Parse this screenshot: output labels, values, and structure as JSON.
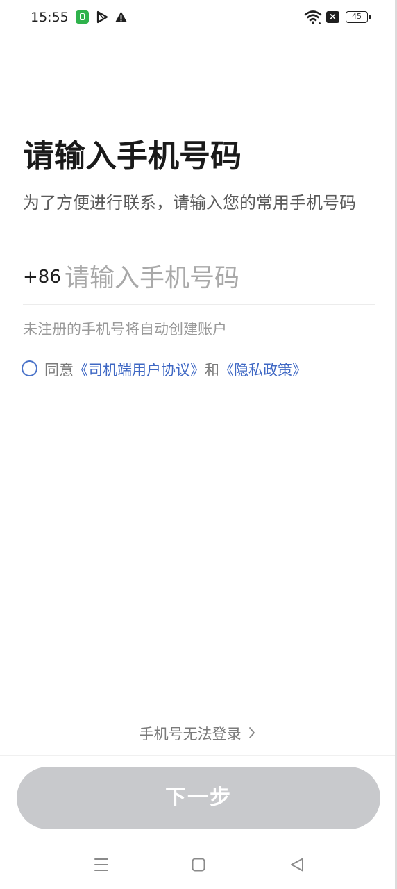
{
  "status_bar": {
    "time": "15:55",
    "battery": "45",
    "icons": [
      "app-notification-icon",
      "play-icon",
      "warning-icon",
      "wifi-icon",
      "sim-off-icon",
      "battery-icon"
    ]
  },
  "main": {
    "title": "请输入手机号码",
    "subtitle": "为了方便进行联系，请输入您的常用手机号码",
    "country_code": "+86",
    "phone_placeholder": "请输入手机号码",
    "phone_value": "",
    "hint": "未注册的手机号将自动创建账户",
    "agreement": {
      "checked": false,
      "prefix": "同意",
      "link1": "《司机端用户协议》",
      "connector": "和",
      "link2": "《隐私政策》"
    }
  },
  "footer": {
    "cannot_login": "手机号无法登录",
    "next_button": "下一步"
  },
  "colors": {
    "link": "#3f68c4",
    "button_disabled": "#c8c9cc",
    "radio": "#4a73c9"
  },
  "nav_bar": {
    "icons": [
      "menu-icon",
      "home-icon",
      "back-icon"
    ]
  }
}
